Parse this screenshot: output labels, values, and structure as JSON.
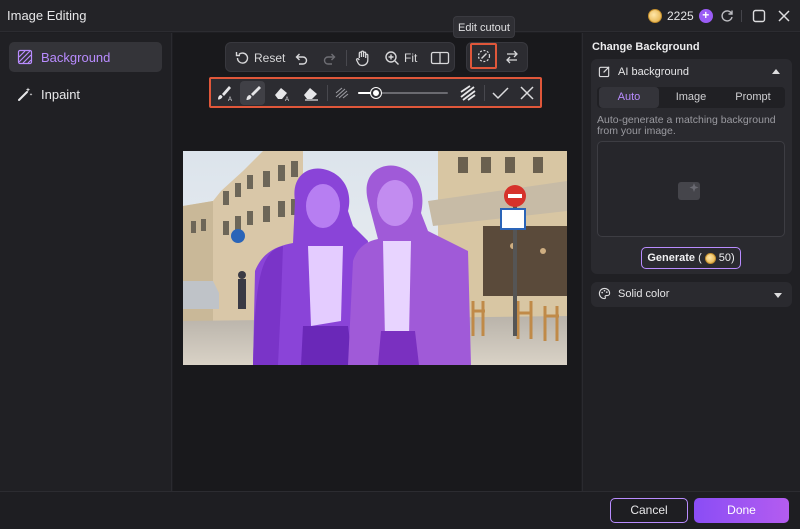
{
  "window": {
    "title": "Image Editing"
  },
  "credits": {
    "count": "2225",
    "add_icon": "plus-icon"
  },
  "sidebar": {
    "items": [
      {
        "label": "Background",
        "icon": "background-pattern-icon",
        "active": true
      },
      {
        "label": "Inpaint",
        "icon": "magic-wand-icon",
        "active": false
      }
    ]
  },
  "toolbar": {
    "reset_label": "Reset",
    "fit_label": "Fit",
    "tooltip": "Edit cutout",
    "brush_size_percent": 20
  },
  "right_panel": {
    "title": "Change Background",
    "ai_background": {
      "label": "AI background",
      "tabs": [
        "Auto",
        "Image",
        "Prompt"
      ],
      "active_tab": "Auto",
      "description": "Auto-generate a matching background from your image.",
      "generate_label": "Generate",
      "generate_open": "(",
      "generate_cost": "50)"
    },
    "solid_color": {
      "label": "Solid color"
    }
  },
  "footer": {
    "cancel_label": "Cancel",
    "done_label": "Done"
  },
  "colors": {
    "accent": "#b98cff",
    "highlight_border": "#e0573a",
    "done_bg": "#8a4df5"
  }
}
